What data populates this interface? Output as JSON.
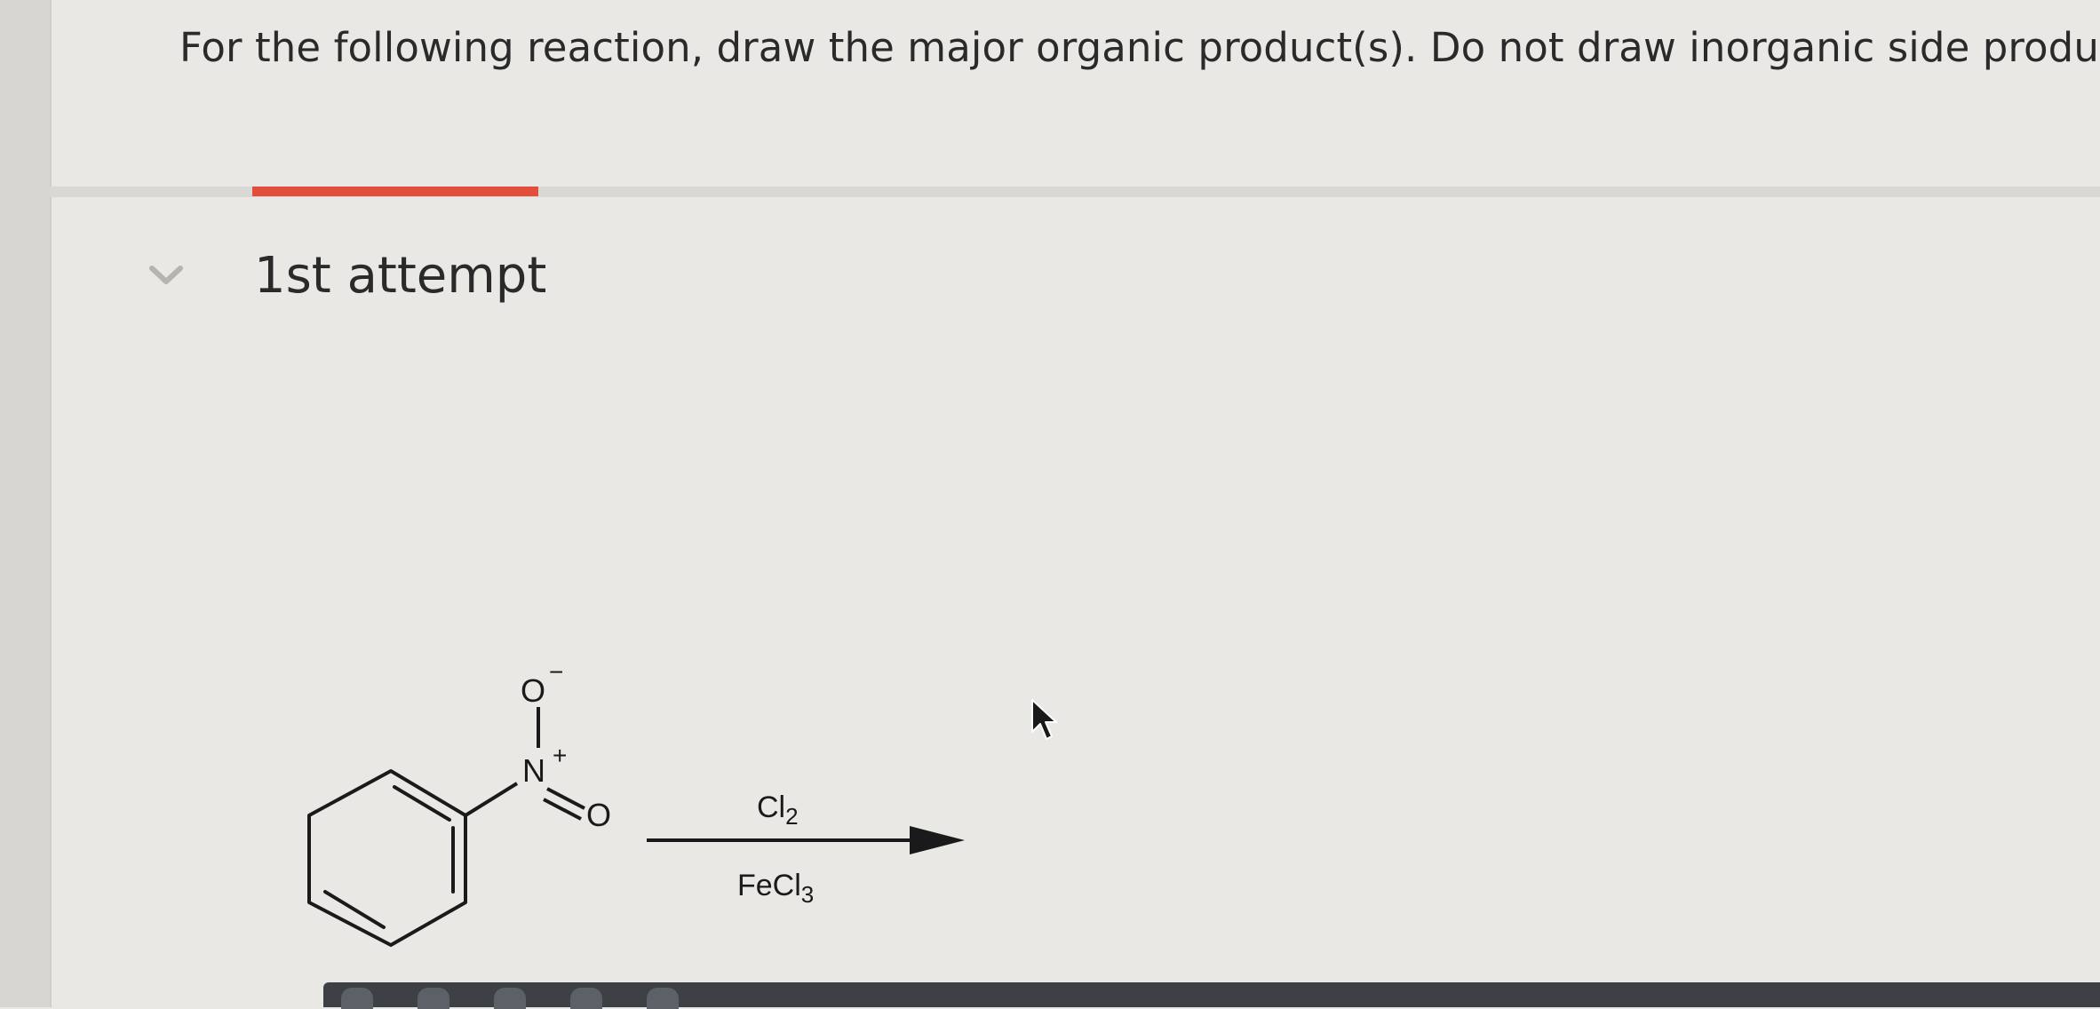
{
  "question": {
    "text": "For the following reaction, draw the major organic product(s). Do not draw inorganic side products."
  },
  "attempt": {
    "title": "1st attempt"
  },
  "reaction": {
    "charge_top": "O",
    "charge_top_sign": "−",
    "nitrogen": "N",
    "nitrogen_sign": "+",
    "oxygen_right": "O",
    "reagent_top_main": "Cl",
    "reagent_top_sub": "2",
    "reagent_bottom_main": "FeCl",
    "reagent_bottom_sub": "3"
  },
  "colors": {
    "accent": "#e34d3c",
    "background": "#e9e8e4",
    "toolbar": "#3d4045"
  },
  "icons": [
    "chevron-down-icon",
    "mouse-pointer-icon"
  ]
}
